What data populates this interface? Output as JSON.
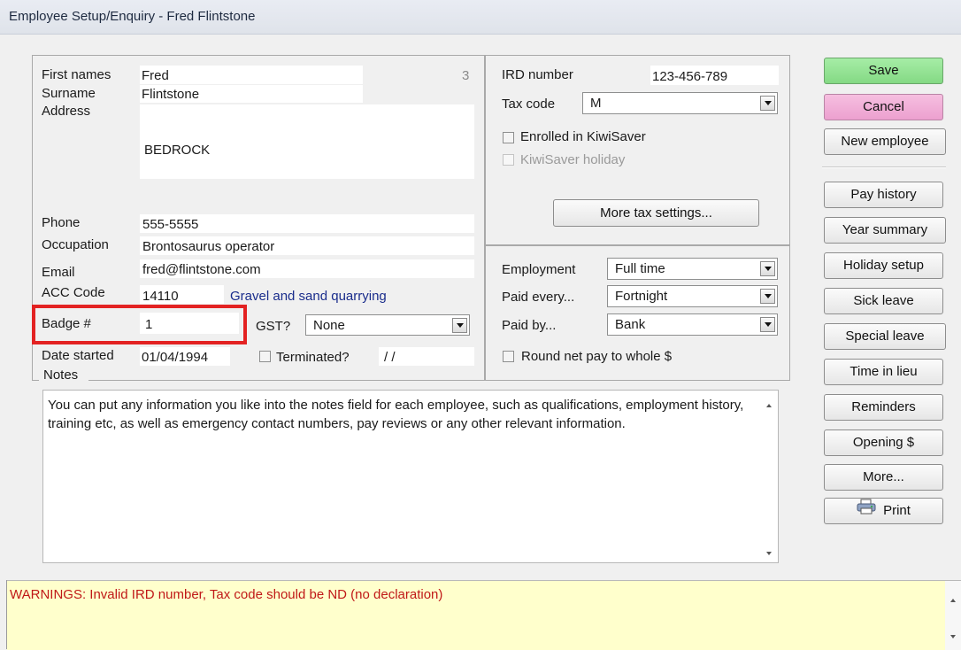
{
  "window": {
    "title": "Employee Setup/Enquiry - Fred Flintstone"
  },
  "personal": {
    "first_names_label": "First names",
    "first_names_value": "Fred",
    "record_number": "3",
    "surname_label": "Surname",
    "surname_value": "Flintstone",
    "address_label": "Address",
    "address_value": "BEDROCK",
    "phone_label": "Phone",
    "phone_value": "555-5555",
    "occupation_label": "Occupation",
    "occupation_value": "Brontosaurus operator",
    "email_label": "Email",
    "email_value": "fred@flintstone.com",
    "acc_label": "ACC Code",
    "acc_value": "14110",
    "acc_description": "Gravel and sand quarrying",
    "badge_label": "Badge #",
    "badge_value": "1",
    "gst_label": "GST?",
    "gst_value": "None",
    "date_started_label": "Date started",
    "date_started_value": "01/04/1994",
    "terminated_label": "Terminated?",
    "terminated_date": "/ /",
    "notes_label": "Notes",
    "notes_text": "You can put any information you like into the notes field for each employee, such as qualifications, employment history, training etc, as well as emergency contact numbers, pay reviews or any other relevant information."
  },
  "tax": {
    "ird_label": "IRD number",
    "ird_value": "123-456-789",
    "tax_code_label": "Tax code",
    "tax_code_value": "M",
    "kiwisaver_label": "Enrolled in KiwiSaver",
    "kiwisaver_checked": false,
    "kiwisaver_holiday_label": "KiwiSaver holiday",
    "kiwisaver_holiday_checked": false,
    "more_tax_button": "More tax settings..."
  },
  "employment": {
    "employment_label": "Employment",
    "employment_value": "Full time",
    "paid_every_label": "Paid every...",
    "paid_every_value": "Fortnight",
    "paid_by_label": "Paid by...",
    "paid_by_value": "Bank",
    "round_label": "Round net pay to whole $",
    "round_checked": false
  },
  "buttons": {
    "save": "Save",
    "cancel": "Cancel",
    "new_employee": "New employee",
    "pay_history": "Pay history",
    "year_summary": "Year summary",
    "holiday_setup": "Holiday setup",
    "sick_leave": "Sick leave",
    "special_leave": "Special leave",
    "time_in_lieu": "Time in lieu",
    "reminders": "Reminders",
    "opening": "Opening $",
    "more": "More...",
    "print": "Print"
  },
  "warnings": {
    "text": "WARNINGS: Invalid IRD number, Tax code should be ND (no declaration)"
  },
  "colors": {
    "save_green": "#8ee08e",
    "cancel_pink": "#f0aed6",
    "warning_bg": "#ffffcc",
    "warning_text": "#c01818",
    "acc_link": "#1a2d8c",
    "highlight_red": "#e32222"
  },
  "icons": {
    "print": "printer-icon"
  }
}
